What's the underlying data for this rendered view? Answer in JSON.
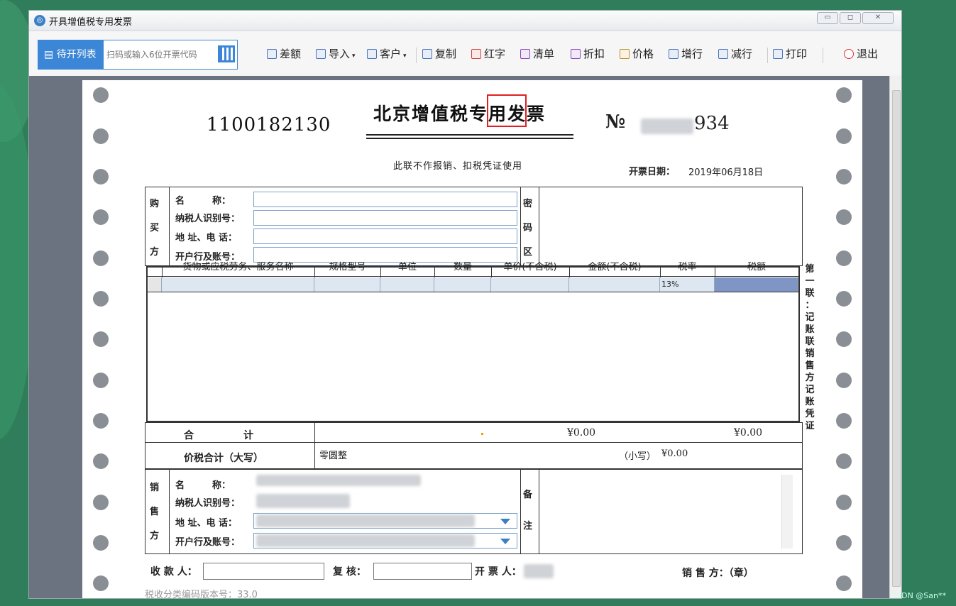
{
  "window": {
    "title": "开具增值税专用发票"
  },
  "toolbar": {
    "queue_label": "待开列表",
    "scan_placeholder": "扫码或输入6位开票代码",
    "items": [
      "差额",
      "导入",
      "客户",
      "复制",
      "红字",
      "清单",
      "折扣",
      "价格",
      "增行",
      "减行",
      "打印",
      "退出"
    ]
  },
  "invoice": {
    "code": "1100182130",
    "title": "北京增值税专用发票",
    "title_part1": "北京增值税",
    "title_part2": "专用",
    "title_part3": "发票",
    "number_label": "№",
    "number_suffix": "934",
    "note": "此联不作报销、扣税凭证使用",
    "date_label": "开票日期：",
    "date": "2019年06月18日",
    "buyer": {
      "side_label": [
        "购",
        "买",
        "方"
      ],
      "name_label": "名　　　称：",
      "tax_id_label": "纳税人识别号：",
      "address_label": "地 址、电 话：",
      "bank_label": "开户行及账号："
    },
    "cipher_label": [
      "密",
      "码",
      "区"
    ],
    "table": {
      "headers": [
        "货物或应税劳务、服务名称",
        "规格型号",
        "单位",
        "数量",
        "单价(不含税)",
        "金额(不含税)",
        "税率",
        "税额"
      ],
      "rows": [
        {
          "tax_rate": "13%"
        }
      ]
    },
    "side_note": [
      "第",
      "一",
      "联",
      "：",
      "记",
      "账",
      "联",
      "销",
      "售",
      "方",
      "记",
      "账",
      "凭",
      "证"
    ],
    "total_label": "合　　　　　计",
    "total_amount": "¥0.00",
    "total_tax": "¥0.00",
    "grand_total_label": "价税合计（大写）",
    "grand_total_words": "零圆整",
    "grand_total_small_label": "（小写）",
    "grand_total_small": "¥0.00",
    "seller": {
      "side_label": [
        "销",
        "售",
        "方"
      ],
      "name_label": "名　　　称：",
      "tax_id_label": "纳税人识别号：",
      "address_label": "地 址、电 话：",
      "bank_label": "开户行及账号："
    },
    "remark_label": [
      "备",
      "注"
    ],
    "footer": {
      "payee_label": "收 款 人：",
      "reviewer_label": "复 核：",
      "issuer_label": "开 票 人：",
      "seller_seal_label": "销 售 方：（章）",
      "version": "税收分类编码版本号：33.0"
    }
  },
  "watermark": "CSDN @San**",
  "colors": {
    "accent": "#3b86d6",
    "highlight": "#e02020",
    "selected_cell": "#7f96c4"
  }
}
